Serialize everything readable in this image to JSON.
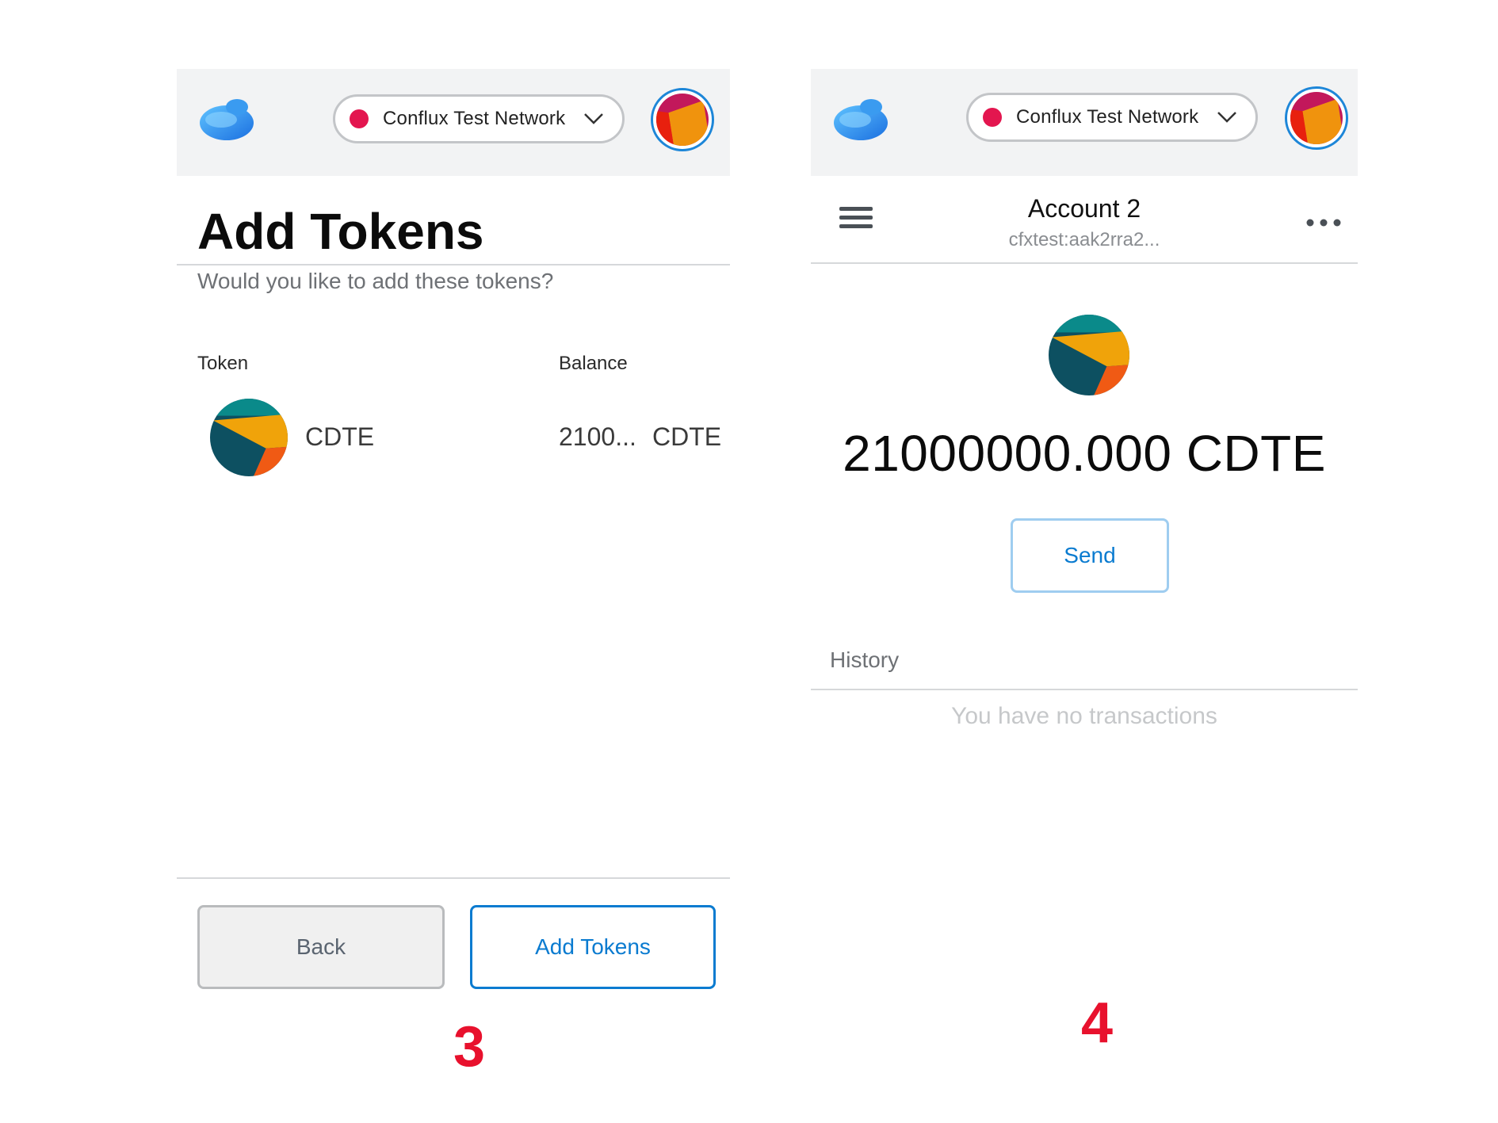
{
  "screen3": {
    "network": "Conflux Test Network",
    "title": "Add Tokens",
    "subtitle": "Would you like to add these tokens?",
    "columns": {
      "token": "Token",
      "balance": "Balance"
    },
    "token_row": {
      "symbol": "CDTE",
      "balance": "2100...",
      "balance_symbol": "CDTE"
    },
    "buttons": {
      "back": "Back",
      "add": "Add Tokens"
    }
  },
  "screen4": {
    "network": "Conflux Test Network",
    "account_name": "Account 2",
    "account_address": "cfxtest:aak2rra2...",
    "balance": "21000000.000 CDTE",
    "send": "Send",
    "history": "History",
    "empty": "You have no transactions"
  },
  "steps": {
    "left": "3",
    "right": "4"
  },
  "colors": {
    "accent": "#0a7bd0",
    "network_dot": "#e3164f",
    "step_label": "#e8112d",
    "header_bg": "#f2f3f4"
  },
  "icons": [
    "conflux-logo-icon",
    "chevron-down-icon",
    "account-avatar-icon",
    "token-icon",
    "hamburger-menu-icon",
    "more-options-icon"
  ]
}
